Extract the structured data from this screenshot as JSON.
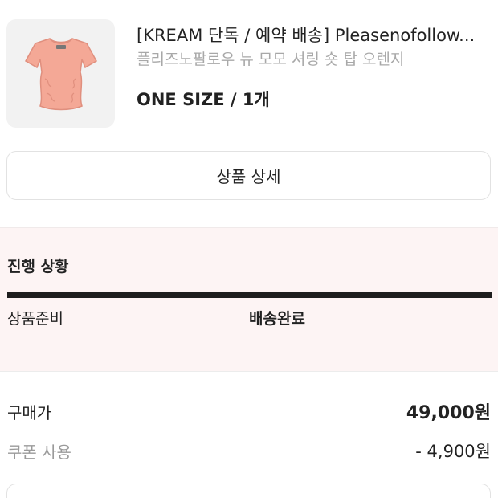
{
  "product": {
    "title": "[KREAM 단독 / 예약 배송] Pleasenofollow...",
    "subtitle": "플리즈노팔로우 뉴 모모 셔링 숏 탑 오렌지",
    "option": "ONE SIZE / 1개",
    "image_icon": "shirt-thumbnail",
    "shirt_color": "#f4a896"
  },
  "actions": {
    "detail_label": "상품 상세"
  },
  "progress": {
    "title": "진행 상황",
    "steps": [
      "상품준비",
      "배송완료"
    ],
    "current_step": "배송완료"
  },
  "payment": {
    "price_label": "구매가",
    "price_value": "49,000원",
    "coupon_label": "쿠폰 사용",
    "coupon_value": "- 4,900원"
  },
  "colors": {
    "status_bg": "#fdf4f4",
    "progress_bar": "#1e1e1e"
  }
}
